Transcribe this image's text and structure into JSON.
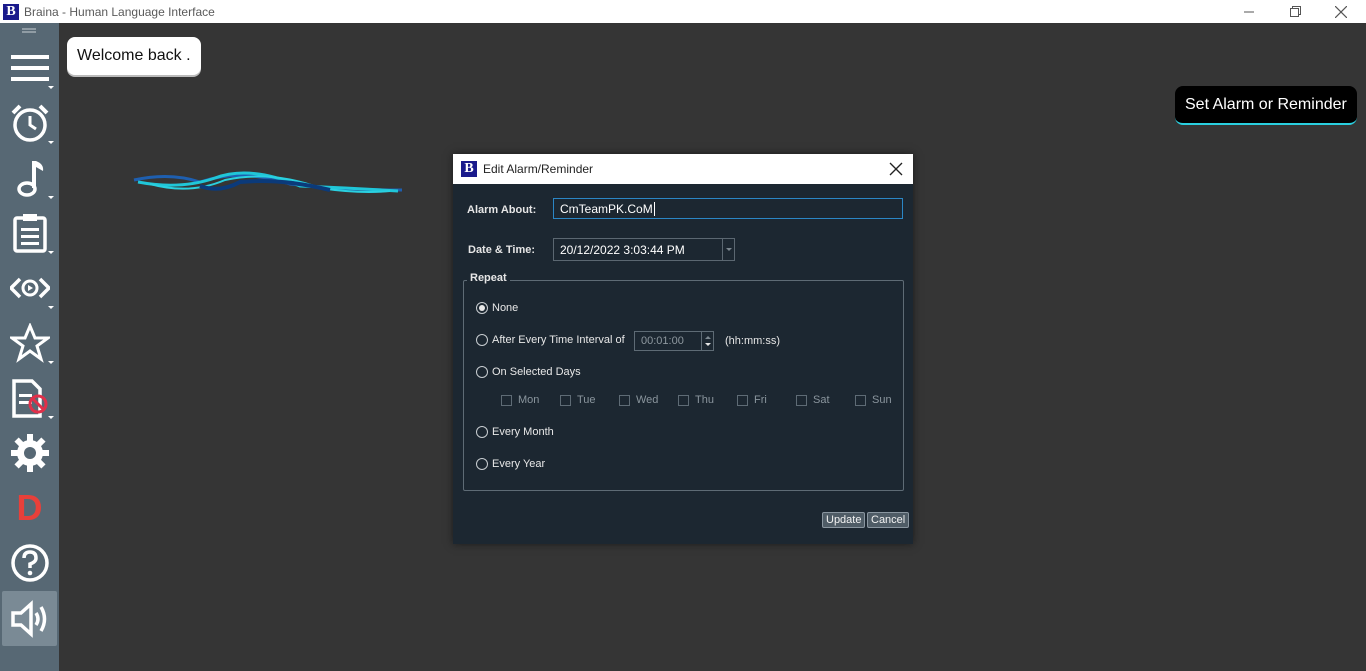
{
  "window": {
    "title": "Braina - Human Language Interface",
    "logo_letter": "B"
  },
  "bubbles": {
    "welcome": "Welcome back .",
    "set_alarm": "Set Alarm or Reminder"
  },
  "sidebar": {
    "items": [
      {
        "icon": "menu-icon"
      },
      {
        "icon": "alarm-clock-icon"
      },
      {
        "icon": "music-note-icon"
      },
      {
        "icon": "notes-clipboard-icon"
      },
      {
        "icon": "eye-view-icon"
      },
      {
        "icon": "star-icon"
      },
      {
        "icon": "document-blocked-icon"
      },
      {
        "icon": "gear-icon"
      },
      {
        "icon": "dictation-d-icon",
        "letter": "D"
      },
      {
        "icon": "help-icon"
      },
      {
        "icon": "speaker-icon"
      }
    ]
  },
  "dialog": {
    "title": "Edit Alarm/Reminder",
    "logo_letter": "B",
    "alarm_about_label": "Alarm About:",
    "alarm_about_value": "CmTeamPK.CoM",
    "datetime_label": "Date & Time:",
    "datetime_value": "20/12/2022 3:03:44 PM",
    "repeat_label": "Repeat",
    "options": {
      "none": "None",
      "interval": "After Every Time Interval of",
      "selected_days": "On Selected Days",
      "every_month": "Every Month",
      "every_year": "Every Year"
    },
    "selected_option": "none",
    "interval_value": "00:01:00",
    "interval_unit": "(hh:mm:ss)",
    "days": [
      "Mon",
      "Tue",
      "Wed",
      "Thu",
      "Fri",
      "Sat",
      "Sun"
    ],
    "update_label": "Update",
    "cancel_label": "Cancel"
  },
  "colors": {
    "background": "#353535",
    "sidebar": "#576874",
    "dialog": "#1c2731",
    "accent_cyan": "#2ad0e0"
  }
}
